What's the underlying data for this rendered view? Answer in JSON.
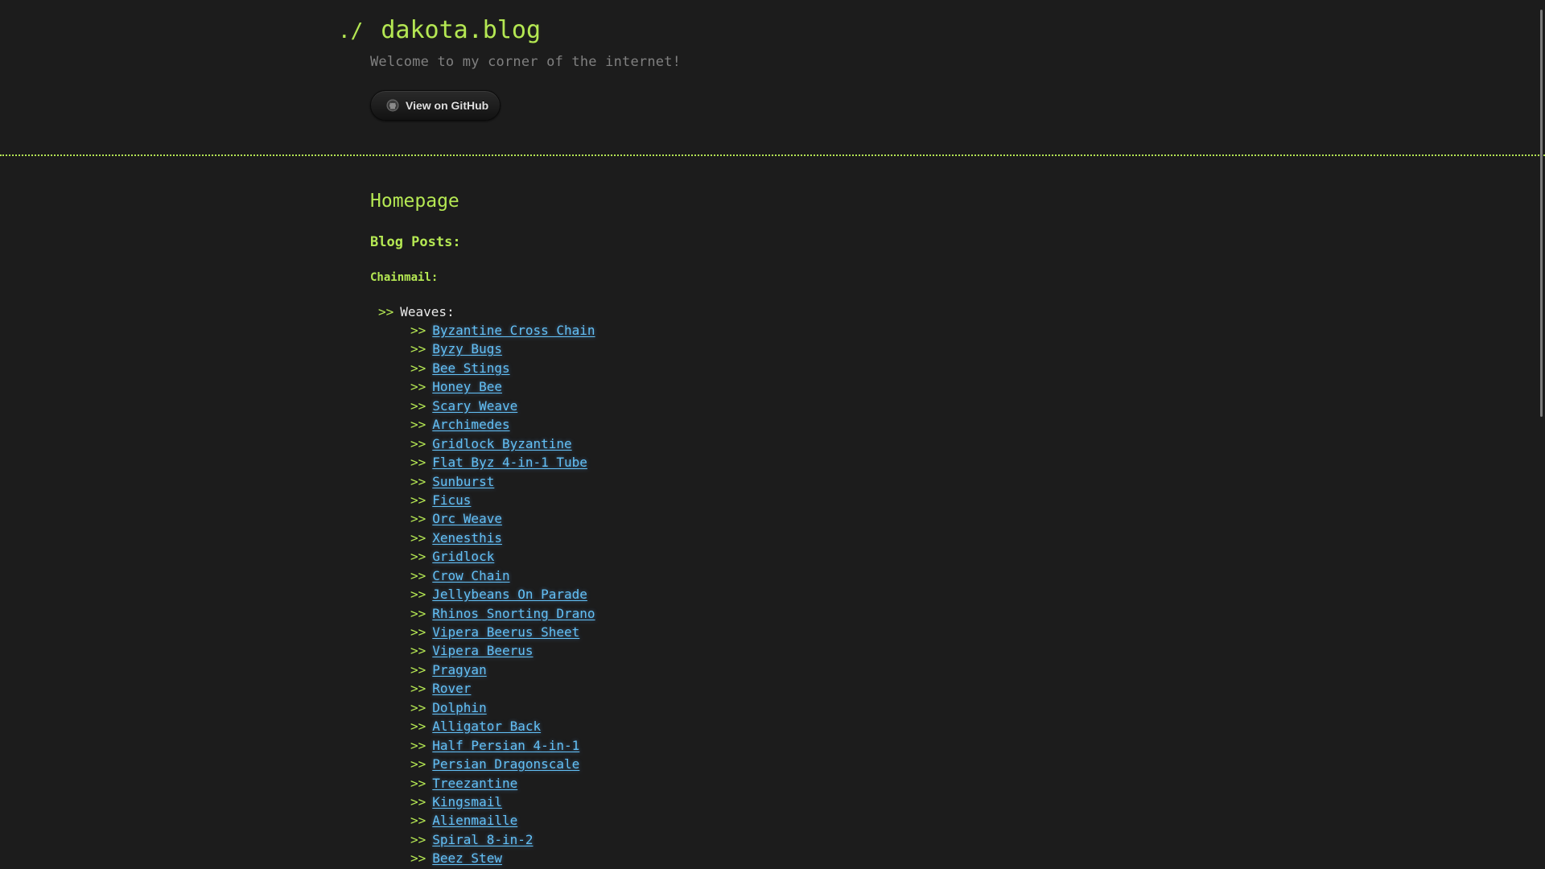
{
  "header": {
    "prompt": "./",
    "title": "dakota.blog",
    "tagline": "Welcome to my corner of the internet!",
    "github_button": {
      "label": "View on GitHub",
      "icon": "github-icon"
    }
  },
  "main": {
    "page_heading": "Homepage",
    "section_heading": "Blog Posts:",
    "category_heading": "Chainmail:",
    "group": {
      "arrow": ">>",
      "label": "Weaves:"
    },
    "item_arrow": ">>",
    "posts": [
      "Byzantine Cross Chain",
      "Byzy Bugs",
      "Bee Stings",
      "Honey Bee",
      "Scary Weave",
      "Archimedes",
      "Gridlock Byzantine",
      "Flat Byz 4-in-1 Tube",
      "Sunburst",
      "Ficus",
      "Orc Weave",
      "Xenesthis",
      "Gridlock",
      "Crow Chain",
      "Jellybeans On Parade",
      "Rhinos Snorting Drano",
      "Vipera Beerus Sheet",
      "Vipera Beerus",
      "Pragyan",
      "Rover",
      "Dolphin",
      "Alligator Back",
      "Half Persian 4-in-1",
      "Persian Dragonscale",
      "Treezantine",
      "Kingsmail",
      "Alienmaille",
      "Spiral 8-in-2",
      "Beez Stew"
    ]
  },
  "colors": {
    "background": "#1c1c1c",
    "accent": "#b5e853",
    "link": "#63c0f5",
    "muted": "#808080"
  }
}
